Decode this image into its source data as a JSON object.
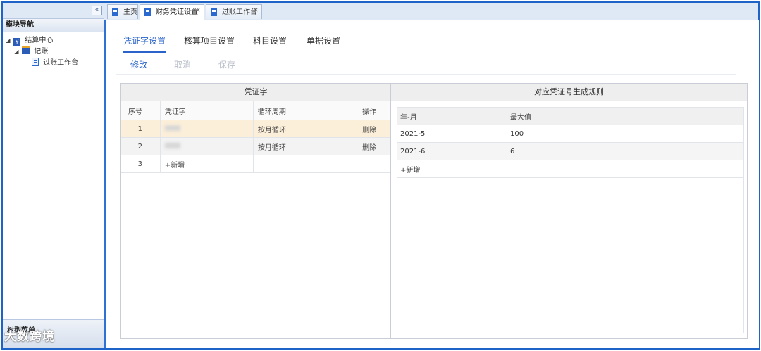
{
  "leftnav": {
    "collapse_symbol": "«",
    "title": "模块导航",
    "tree": [
      {
        "label": "结算中心",
        "icon": "yen-icon",
        "arrow": "◢"
      },
      {
        "label": "记账",
        "icon": "folder-icon",
        "arrow": "◢"
      },
      {
        "label": "过账工作台",
        "icon": "document-icon"
      }
    ],
    "bottom_tab": "树型菜单"
  },
  "tabs": [
    {
      "label": "主页",
      "close": ""
    },
    {
      "label": "财务凭证设置",
      "close": "✕",
      "active": true
    },
    {
      "label": "过账工作台",
      "close": "✕"
    }
  ],
  "subtabs": [
    "凭证字设置",
    "核算项目设置",
    "科目设置",
    "单据设置"
  ],
  "actions": {
    "edit": "修改",
    "cancel": "取消",
    "save": "保存"
  },
  "left_panel": {
    "title": "凭证字",
    "headers": [
      "序号",
      "凭证字",
      "循环周期",
      "操作"
    ],
    "rows": [
      {
        "no": "1",
        "cycle": "按月循环",
        "op": "删除"
      },
      {
        "no": "2",
        "cycle": "按月循环",
        "op": "删除"
      },
      {
        "no": "3",
        "add": "+新增"
      }
    ]
  },
  "right_panel": {
    "title": "对应凭证号生成规则",
    "headers": [
      "年-月",
      "最大值"
    ],
    "rows": [
      {
        "month": "2021-5",
        "max": "100"
      },
      {
        "month": "2021-6",
        "max": "6"
      }
    ],
    "add": "+新增"
  },
  "watermark": "大数跨境",
  "colors": {
    "accent": "#2a63c9",
    "frame": "#1e63c8",
    "selected_row": "#fcefd9"
  }
}
